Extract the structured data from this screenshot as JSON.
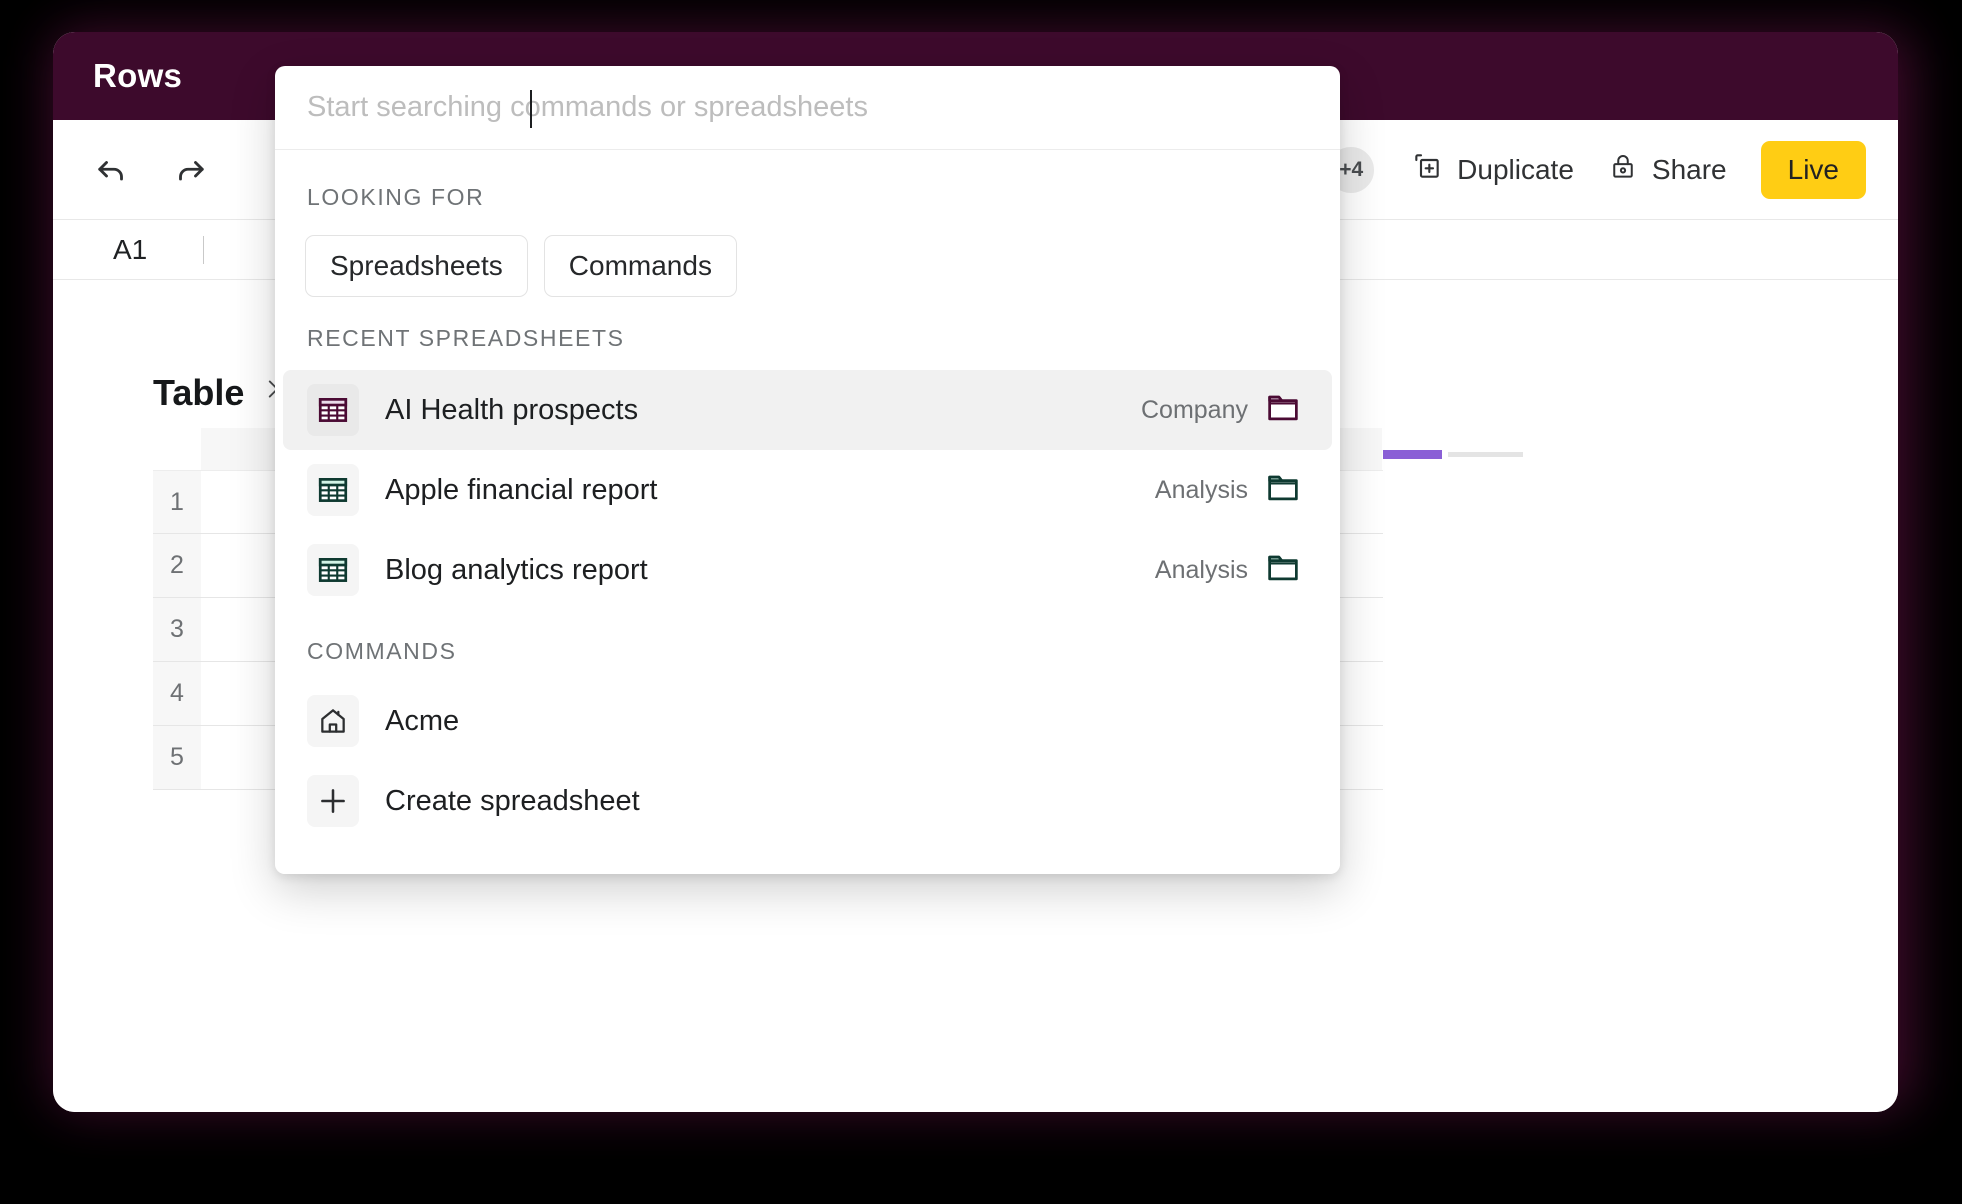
{
  "app": {
    "brand": "Rows",
    "header_bg": "#3d0a2c"
  },
  "toolbar": {
    "undo_icon": "undo-icon",
    "redo_icon": "redo-icon",
    "avatars_overflow": "+4",
    "duplicate_label": "Duplicate",
    "duplicate_icon": "duplicate-icon",
    "share_label": "Share",
    "share_icon": "lock-icon",
    "live_label": "Live",
    "live_color": "#ffcd14"
  },
  "formula_bar": {
    "cell_reference": "A1",
    "value": ""
  },
  "sheet": {
    "table_title": "Table",
    "expand_icon": "chevron-right-icon",
    "more_icon": "ellipsis-icon",
    "row_numbers": [
      "1",
      "2",
      "3",
      "4",
      "5"
    ],
    "tab_accent": "#8a5fd6",
    "tab_dot": "#35a866"
  },
  "palette": {
    "search_placeholder": "Start searching commands or spreadsheets",
    "search_value": "",
    "looking_for_label": "Looking for",
    "filters": [
      {
        "label": "Spreadsheets",
        "name": "filter-spreadsheets"
      },
      {
        "label": "Commands",
        "name": "filter-commands"
      }
    ],
    "recent_label": "Recent spreadsheets",
    "recent": [
      {
        "title": "AI Health prospects",
        "folder": "Company",
        "icon": "spreadsheet-icon",
        "folder_icon": "folder-icon",
        "accent": "#4b0b34",
        "accent_fill": "#eadcea",
        "selected": true
      },
      {
        "title": "Apple financial report",
        "folder": "Analysis",
        "icon": "spreadsheet-icon",
        "folder_icon": "folder-icon",
        "accent": "#0f3a31",
        "accent_fill": "#d2f3e6",
        "selected": false
      },
      {
        "title": "Blog analytics report",
        "folder": "Analysis",
        "icon": "spreadsheet-icon",
        "folder_icon": "folder-icon",
        "accent": "#0f3a31",
        "accent_fill": "#d2f3e6",
        "selected": false
      }
    ],
    "commands_label": "Commands",
    "commands": [
      {
        "label": "Acme",
        "icon": "home-icon"
      },
      {
        "label": "Create spreadsheet",
        "icon": "plus-icon"
      }
    ]
  }
}
